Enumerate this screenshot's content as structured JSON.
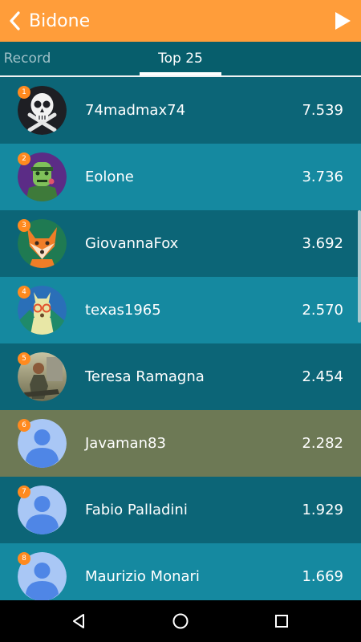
{
  "header": {
    "title": "Bidone",
    "back_icon": "chevron-left-icon",
    "play_icon": "play-icon"
  },
  "tabs": [
    {
      "label": "Record",
      "selected": false
    },
    {
      "label": "Top 25",
      "selected": true
    }
  ],
  "players": [
    {
      "rank": "1",
      "name": "74madmax74",
      "score": "7.539",
      "avatar": "skull-avatar"
    },
    {
      "rank": "2",
      "name": "Eolone",
      "score": "3.736",
      "avatar": "zombie-avatar"
    },
    {
      "rank": "3",
      "name": "GiovannaFox",
      "score": "3.692",
      "avatar": "fox-avatar"
    },
    {
      "rank": "4",
      "name": "texas1965",
      "score": "2.570",
      "avatar": "llama-avatar"
    },
    {
      "rank": "5",
      "name": "Teresa Ramagna",
      "score": "2.454",
      "avatar": "photo-avatar"
    },
    {
      "rank": "6",
      "name": "Javaman83",
      "score": "2.282",
      "avatar": "default-person-avatar"
    },
    {
      "rank": "7",
      "name": "Fabio Palladini",
      "score": "1.929",
      "avatar": "default-person-avatar"
    },
    {
      "rank": "8",
      "name": "Maurizio Monari",
      "score": "1.669",
      "avatar": "default-person-avatar"
    }
  ],
  "colors": {
    "header": "#ff9d3a",
    "tab_bar": "#075e6c",
    "row_dark": "#0c6577",
    "row_light": "#1589a0",
    "row_current_user": "#6d7955",
    "rank_badge": "#ff8a1f"
  },
  "nav_bar": [
    "back-triangle-icon",
    "home-circle-icon",
    "recents-square-icon"
  ]
}
